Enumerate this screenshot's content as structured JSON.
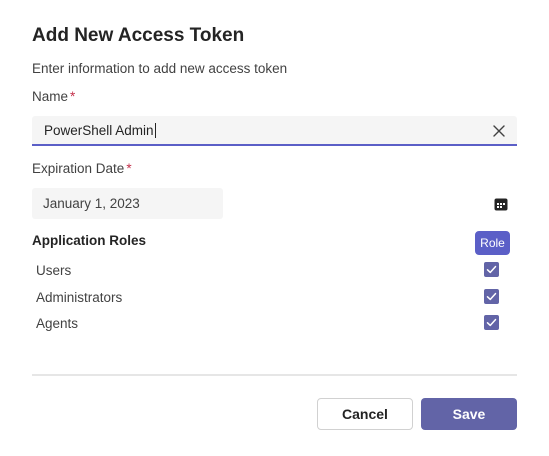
{
  "dialog": {
    "title": "Add New Access Token",
    "subtitle": "Enter information to add new access token"
  },
  "name_field": {
    "label": "Name",
    "required_mark": "*",
    "value": "PowerShell Admin",
    "clear_icon": "close-icon"
  },
  "expiration_field": {
    "label": "Expiration Date",
    "required_mark": "*",
    "value": "January 1, 2023",
    "calendar_icon": "calendar-icon"
  },
  "roles": {
    "header": "Application Roles",
    "column_label": "Role",
    "items": [
      {
        "label": "Users",
        "checked": true
      },
      {
        "label": "Administrators",
        "checked": true
      },
      {
        "label": "Agents",
        "checked": true
      }
    ]
  },
  "actions": {
    "cancel_label": "Cancel",
    "save_label": "Save"
  },
  "colors": {
    "accent": "#6264a7",
    "focus_underline": "#5b5fc7",
    "required": "#c4314b"
  }
}
